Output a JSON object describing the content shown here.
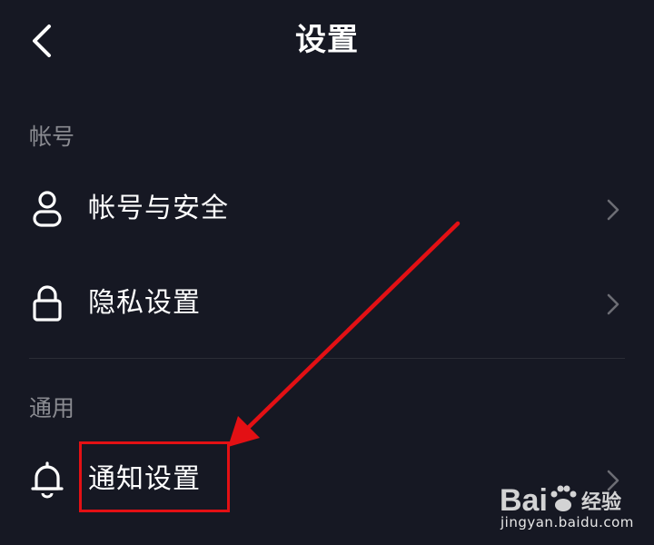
{
  "header": {
    "title": "设置",
    "back_icon": "chevron-left-icon"
  },
  "sections": [
    {
      "label": "帐号",
      "items": [
        {
          "label": "帐号与安全",
          "icon": "user-icon"
        },
        {
          "label": "隐私设置",
          "icon": "lock-icon"
        }
      ]
    },
    {
      "label": "通用",
      "items": [
        {
          "label": "通知设置",
          "icon": "bell-icon"
        }
      ]
    }
  ],
  "annotation": {
    "color": "#e31014",
    "target": "通知设置"
  },
  "watermark": {
    "brand": "Bai du 经验",
    "url": "jingyan.baidu.com"
  },
  "colors": {
    "background": "#161823",
    "text": "#ffffff",
    "section_label": "#8a8b91",
    "chevron": "#6c6d74"
  }
}
